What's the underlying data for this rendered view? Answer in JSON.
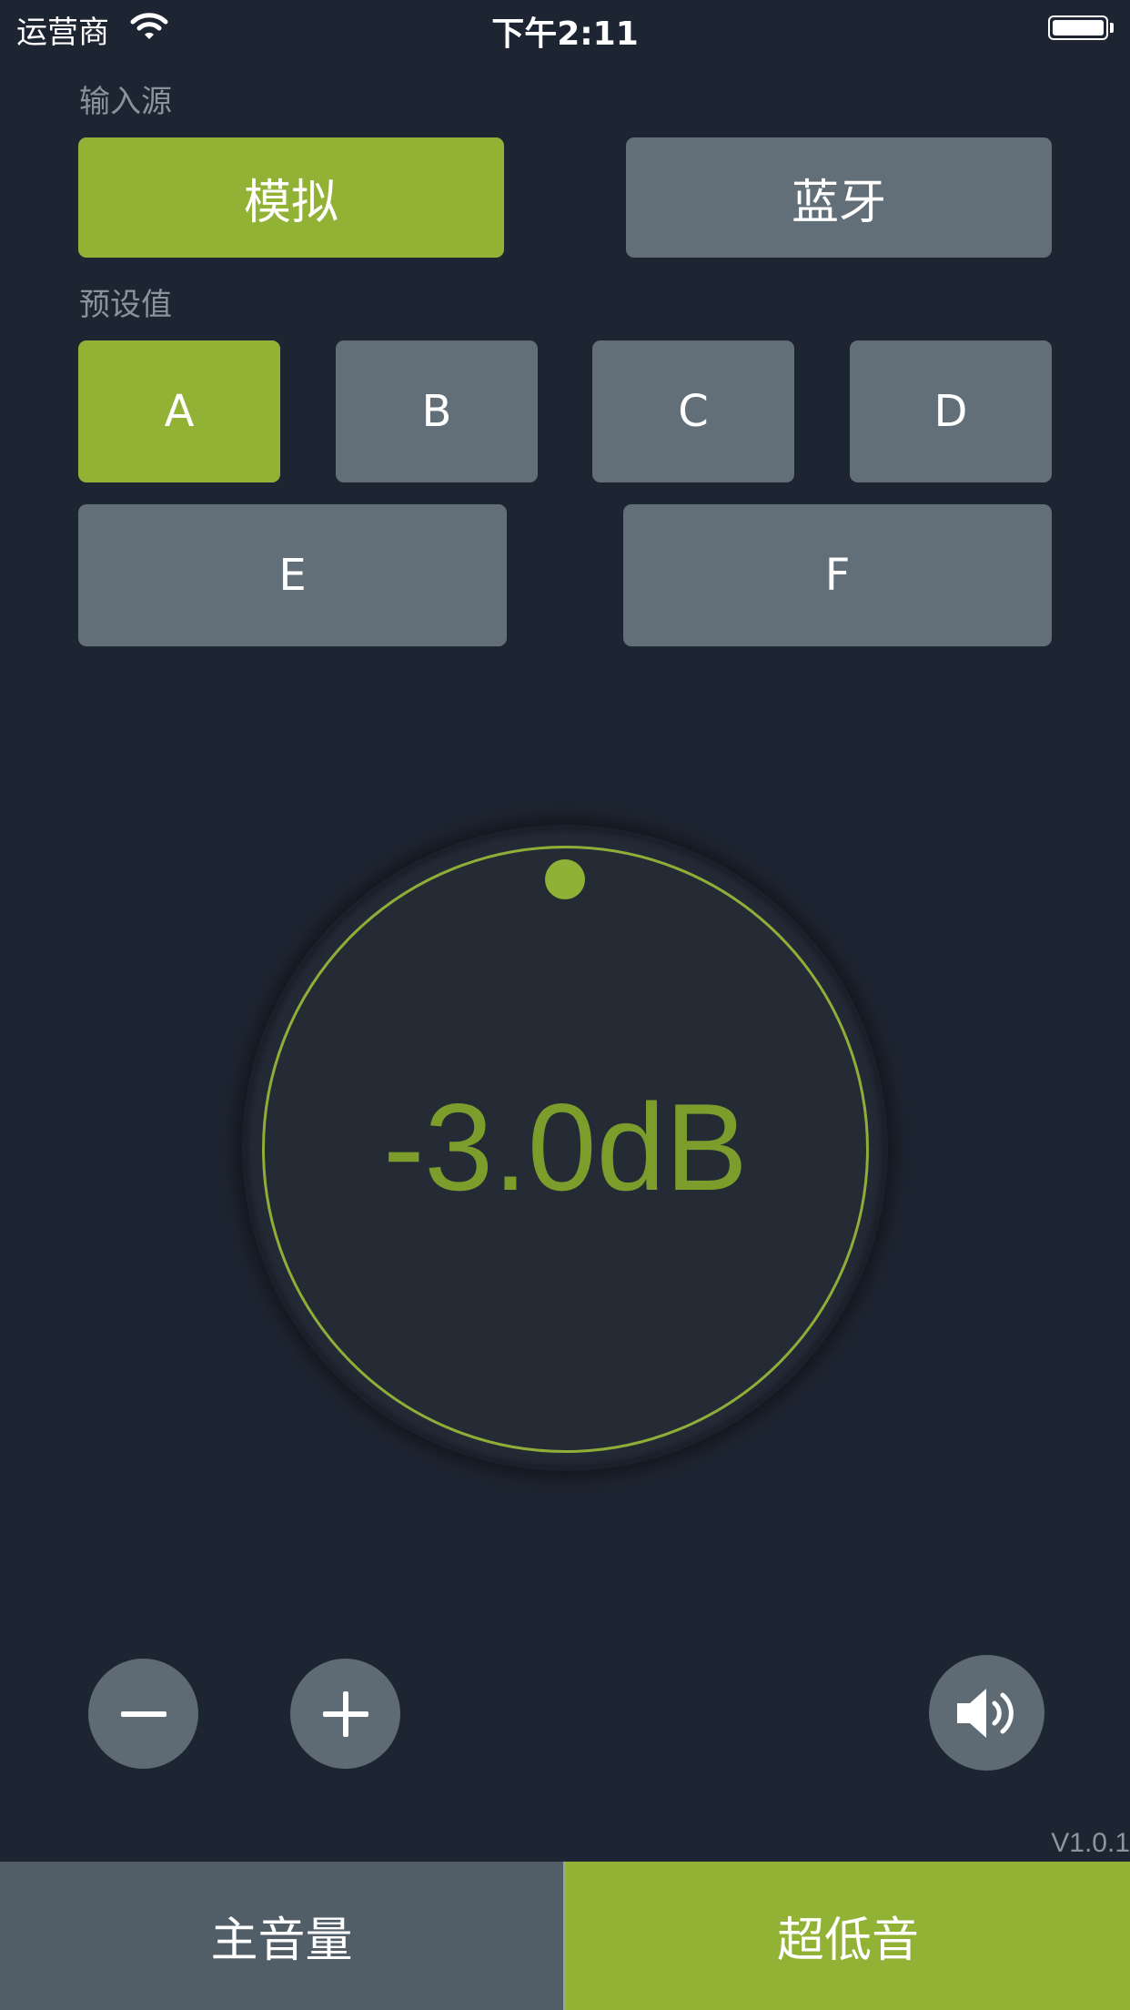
{
  "status_bar": {
    "carrier": "运营商",
    "time": "下午2:11",
    "icons": [
      "wifi-icon",
      "battery-icon"
    ]
  },
  "input_source": {
    "label": "输入源",
    "options": [
      "模拟",
      "蓝牙"
    ],
    "selected": "模拟"
  },
  "presets": {
    "label": "预设值",
    "options": [
      "A",
      "B",
      "C",
      "D",
      "E",
      "F"
    ],
    "selected": "A"
  },
  "dial": {
    "value": "-3.0dB"
  },
  "controls": {
    "icons": [
      "minus-icon",
      "plus-icon",
      "speaker-icon"
    ]
  },
  "version": "V1.0.1",
  "tabs": {
    "items": [
      "主音量",
      "超低音"
    ],
    "selected": "超低音"
  },
  "colors": {
    "background": "#1e2532",
    "accent": "#92b236",
    "button": "#626f78",
    "tab_inactive": "#525e67"
  }
}
